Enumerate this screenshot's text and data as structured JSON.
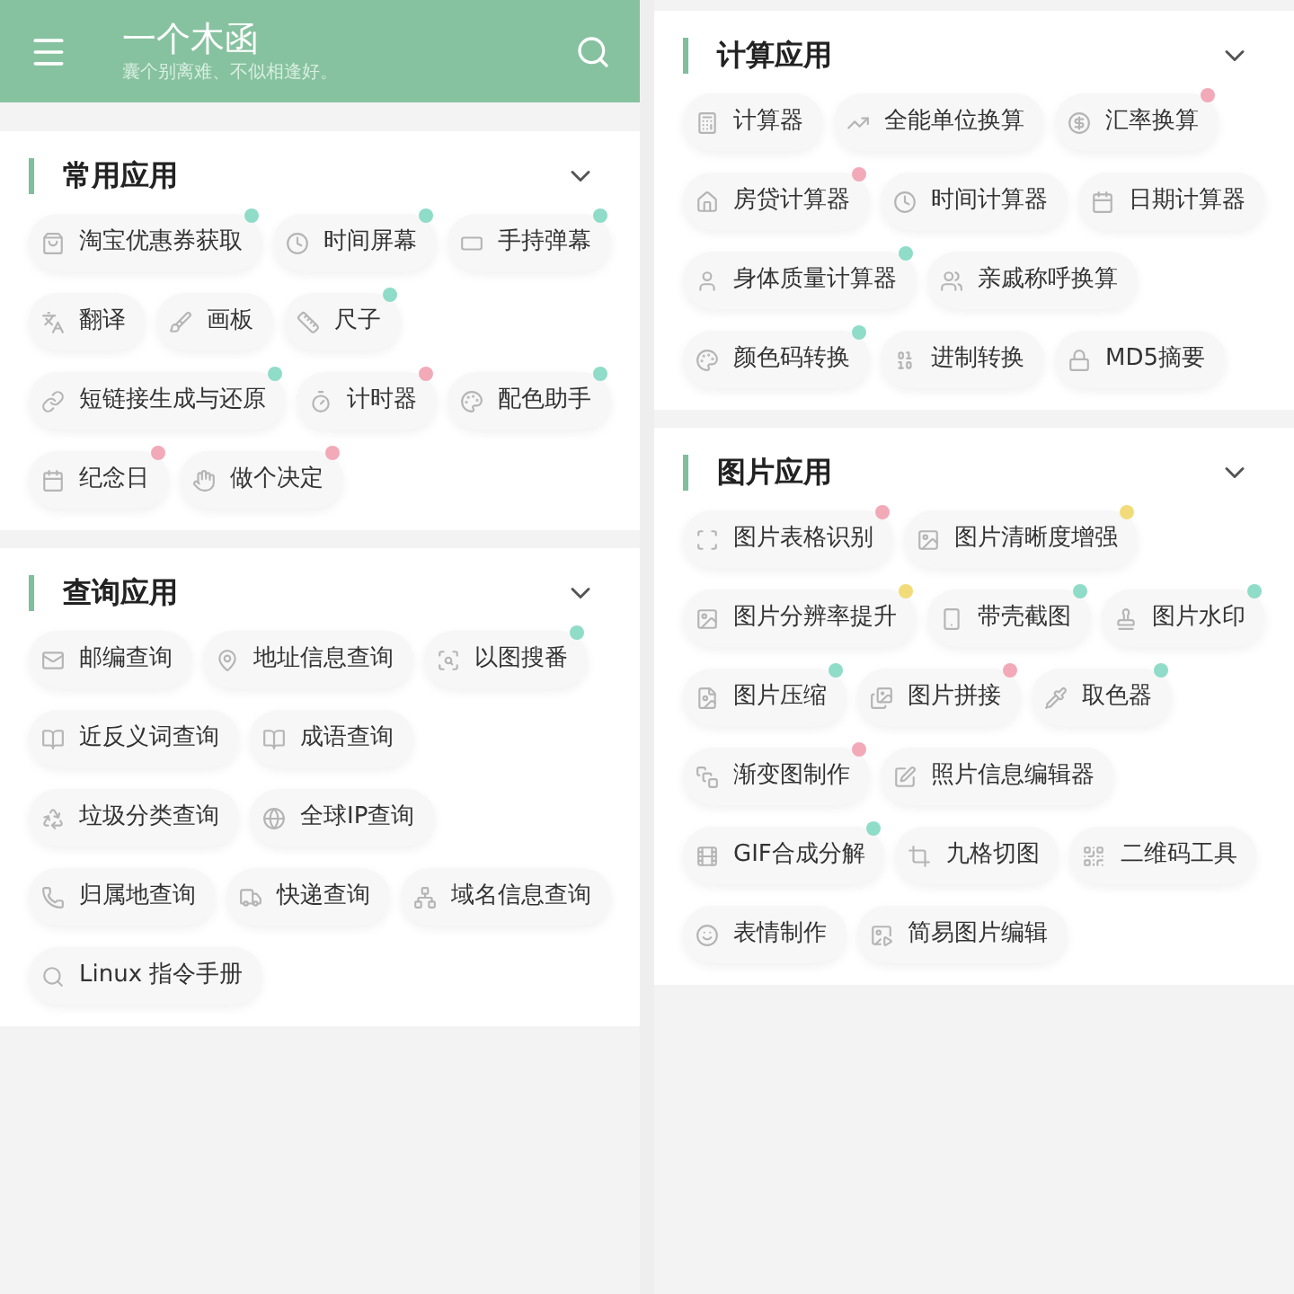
{
  "header": {
    "title": "一个木函",
    "subtitle": "囊个别离难、不似相逢好。"
  },
  "columns": [
    {
      "sections": [
        {
          "title": "常用应用",
          "expanded": true,
          "items": [
            {
              "label": "淘宝优惠券获取",
              "color": "#8fdcc8"
            },
            {
              "label": "时间屏幕",
              "color": "#8fdcc8"
            },
            {
              "label": "手持弹幕",
              "color": "#8fdcc8"
            },
            {
              "label": "翻译"
            },
            {
              "label": "画板"
            },
            {
              "label": "尺子",
              "color": "#8fdcc8"
            },
            {
              "label": "短链接生成与还原",
              "color": "#8fdcc8"
            },
            {
              "label": "计时器",
              "color": "#f2a9b8"
            },
            {
              "label": "配色助手",
              "color": "#8fdcc8"
            },
            {
              "label": "纪念日",
              "color": "#f2a9b8"
            },
            {
              "label": "做个决定",
              "color": "#f2a9b8"
            }
          ]
        },
        {
          "title": "查询应用",
          "expanded": true,
          "items": [
            {
              "label": "邮编查询"
            },
            {
              "label": "地址信息查询"
            },
            {
              "label": "以图搜番",
              "color": "#8fdcc8"
            },
            {
              "label": "近反义词查询"
            },
            {
              "label": "成语查询"
            },
            {
              "label": "垃圾分类查询"
            },
            {
              "label": "全球IP查询"
            },
            {
              "label": "归属地查询"
            },
            {
              "label": "快递查询"
            },
            {
              "label": "域名信息查询"
            },
            {
              "label": "Linux 指令手册"
            }
          ]
        }
      ]
    },
    {
      "sections": [
        {
          "title": "计算应用",
          "expanded": true,
          "items": [
            {
              "label": "计算器"
            },
            {
              "label": "全能单位换算"
            },
            {
              "label": "汇率换算",
              "color": "#f2a9b8"
            },
            {
              "label": "房贷计算器",
              "color": "#f2a9b8"
            },
            {
              "label": "时间计算器"
            },
            {
              "label": "日期计算器"
            },
            {
              "label": "身体质量计算器",
              "color": "#8fdcc8"
            },
            {
              "label": "亲戚称呼换算"
            },
            {
              "label": "颜色码转换",
              "color": "#8fdcc8"
            },
            {
              "label": "进制转换"
            },
            {
              "label": "MD5摘要"
            }
          ]
        },
        {
          "title": "图片应用",
          "expanded": true,
          "items": [
            {
              "label": "图片表格识别",
              "color": "#f2a9b8"
            },
            {
              "label": "图片清晰度增强",
              "color": "#f2dc7a"
            },
            {
              "label": "图片分辨率提升",
              "color": "#f2dc7a"
            },
            {
              "label": "带壳截图",
              "color": "#8fdcc8"
            },
            {
              "label": "图片水印",
              "color": "#8fdcc8"
            },
            {
              "label": "图片压缩",
              "color": "#8fdcc8"
            },
            {
              "label": "图片拼接",
              "color": "#f2a9b8"
            },
            {
              "label": "取色器",
              "color": "#8fdcc8"
            },
            {
              "label": "渐变图制作",
              "color": "#f2a9b8"
            },
            {
              "label": "照片信息编辑器"
            },
            {
              "label": "GIF合成分解",
              "color": "#8fdcc8"
            },
            {
              "label": "九格切图"
            },
            {
              "label": "二维码工具"
            },
            {
              "label": "表情制作"
            },
            {
              "label": "简易图片编辑"
            }
          ]
        }
      ]
    }
  ]
}
